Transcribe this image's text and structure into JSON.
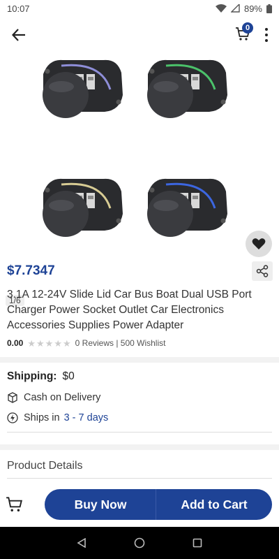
{
  "status_bar": {
    "time": "10:07",
    "battery": "89%"
  },
  "header": {
    "cart_count": "0"
  },
  "gallery": {
    "counter": "1/6",
    "ring_colors": [
      "#8e8ed8",
      "#4bc26a",
      "#d8cc94",
      "#3c66e0"
    ]
  },
  "product": {
    "price": "$7.7347",
    "title": "3.1A 12-24V Slide Lid Car Bus Boat Dual USB Port Charger Power Socket Outlet Car Electronics Accessories Supplies Power Adapter",
    "rating_score": "0.00",
    "reviews_text": "0 Reviews | 500 Wishlist",
    "stars_filled": 0,
    "stars_total": 5
  },
  "shipping": {
    "label": "Shipping:",
    "value": "$0",
    "cod": "Cash on Delivery",
    "ships_in_label": "Ships in",
    "ships_in_value": "3 - 7 days"
  },
  "sections": {
    "product_details": "Product Details"
  },
  "actions": {
    "buy_now": "Buy Now",
    "add_to_cart": "Add to Cart"
  },
  "colors": {
    "brand": "#1e4396",
    "price": "#1e4396"
  },
  "icons": [
    "wifi-icon",
    "signal-icon",
    "battery-icon",
    "back-arrow-icon",
    "cart-icon",
    "more-vert-icon",
    "heart-icon",
    "share-icon",
    "box-icon",
    "lightning-icon",
    "nav-back-icon",
    "nav-home-icon",
    "nav-recents-icon"
  ]
}
